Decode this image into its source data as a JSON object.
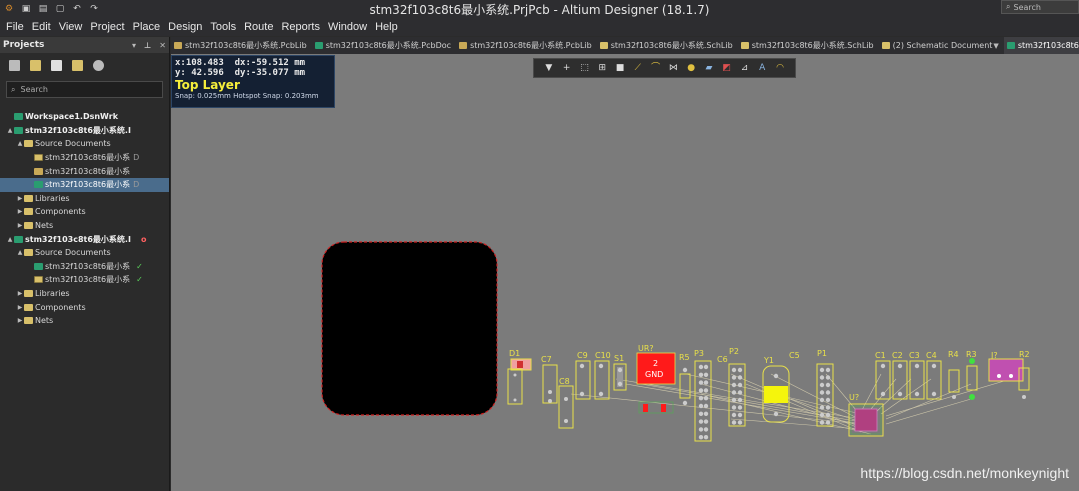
{
  "window": {
    "title": "stm32f103c8t6最小系统.PrjPcb - Altium Designer (18.1.7)",
    "search_placeholder": "Search"
  },
  "menu": [
    "File",
    "Edit",
    "View",
    "Project",
    "Place",
    "Design",
    "Tools",
    "Route",
    "Reports",
    "Window",
    "Help"
  ],
  "projects_panel": {
    "title": "Projects",
    "search_placeholder": "Search",
    "tree": [
      {
        "label": "Workspace1.DsnWrk",
        "level": 0,
        "icon": "workspace-icon",
        "bold": true
      },
      {
        "label": "stm32f103c8t6最小系统.I",
        "level": 0,
        "icon": "pcb-project-icon",
        "bold": true,
        "arrow": "▲"
      },
      {
        "label": "Source Documents",
        "level": 1,
        "icon": "folder-icon",
        "arrow": "▲"
      },
      {
        "label": "stm32f103c8t6最小系",
        "level": 2,
        "icon": "schlib-icon",
        "suffix": "D"
      },
      {
        "label": "stm32f103c8t6最小系",
        "level": 2,
        "icon": "pcblib-icon"
      },
      {
        "label": "stm32f103c8t6最小系",
        "level": 2,
        "icon": "pcbdoc-icon",
        "suffix": "D",
        "selected": true
      },
      {
        "label": "Libraries",
        "level": 1,
        "icon": "folder-icon",
        "arrow": "▶"
      },
      {
        "label": "Components",
        "level": 1,
        "icon": "folder-icon",
        "arrow": "▶"
      },
      {
        "label": "Nets",
        "level": 1,
        "icon": "folder-icon",
        "arrow": "▶"
      },
      {
        "label": "stm32f103c8t6最小系统.I",
        "level": 0,
        "icon": "pcb-project-icon",
        "bold": true,
        "arrow": "▲",
        "dot": "o"
      },
      {
        "label": "Source Documents",
        "level": 1,
        "icon": "folder-icon",
        "arrow": "▲"
      },
      {
        "label": "stm32f103c8t6最小系",
        "level": 2,
        "icon": "pcbdoc-icon",
        "check": "✓"
      },
      {
        "label": "stm32f103c8t6最小系",
        "level": 2,
        "icon": "schlib-icon",
        "check": "✓"
      },
      {
        "label": "Libraries",
        "level": 1,
        "icon": "folder-icon",
        "arrow": "▶"
      },
      {
        "label": "Components",
        "level": 1,
        "icon": "folder-icon",
        "arrow": "▶"
      },
      {
        "label": "Nets",
        "level": 1,
        "icon": "folder-icon",
        "arrow": "▶"
      }
    ]
  },
  "tabs": [
    {
      "label": "stm32f103c8t6最小系统.PcbLib",
      "icon": "pcblib-icon",
      "color": "#c9a957"
    },
    {
      "label": "stm32f103c8t6最小系统.PcbDoc",
      "icon": "pcbdoc-icon",
      "color": "#2a9d70"
    },
    {
      "label": "stm32f103c8t6最小系统.PcbLib",
      "icon": "pcblib-icon",
      "color": "#c9a957"
    },
    {
      "label": "stm32f103c8t6最小系统.SchLib",
      "icon": "schlib-icon",
      "color": "#d8c06a"
    },
    {
      "label": "stm32f103c8t6最小系统.SchLib",
      "icon": "schlib-icon",
      "color": "#d8c06a"
    },
    {
      "label": "(2) Schematic Document",
      "icon": "sch-doc-icon",
      "color": "#d8c06a",
      "dropdown": true
    },
    {
      "label": "stm32f103c8t6最小系",
      "icon": "pcbdoc-icon",
      "color": "#2a9d70",
      "active": true
    }
  ],
  "heads_up": {
    "x": "x:108.483",
    "dx": "dx:-59.512 mm",
    "y": "y: 42.596",
    "dy": "dy:-35.077 mm",
    "layer": "Top Layer",
    "snap": "Snap: 0.025mm Hotspot Snap: 0.203mm"
  },
  "active_bar_icons": [
    "filter-icon",
    "add-icon",
    "select-rect-icon",
    "align-icon",
    "component-icon",
    "route-icon",
    "arc-icon",
    "diff-pair-icon",
    "via-icon",
    "polygon-icon",
    "keepout-icon",
    "dimension-icon",
    "text-icon",
    "arc-draw-icon"
  ],
  "components": {
    "u2_label": "UR?",
    "u2_pin": "2",
    "u2_net": "GND",
    "designators": [
      "D1",
      "C7",
      "C8",
      "C9",
      "C10",
      "S1",
      "R5",
      "P3",
      "C6",
      "P2",
      "Y1",
      "C5",
      "P1",
      "U?",
      "C1",
      "C2",
      "C3",
      "C4",
      "R4",
      "R3",
      "J?",
      "R2"
    ]
  },
  "colors": {
    "canvas": "#7b7b7b",
    "silk": "#e8e04a",
    "top_pad": "#ff1a1a",
    "ratsnest": "#d8d0b0",
    "board": "#000000"
  },
  "watermark": "https://blog.csdn.net/monkeynight"
}
